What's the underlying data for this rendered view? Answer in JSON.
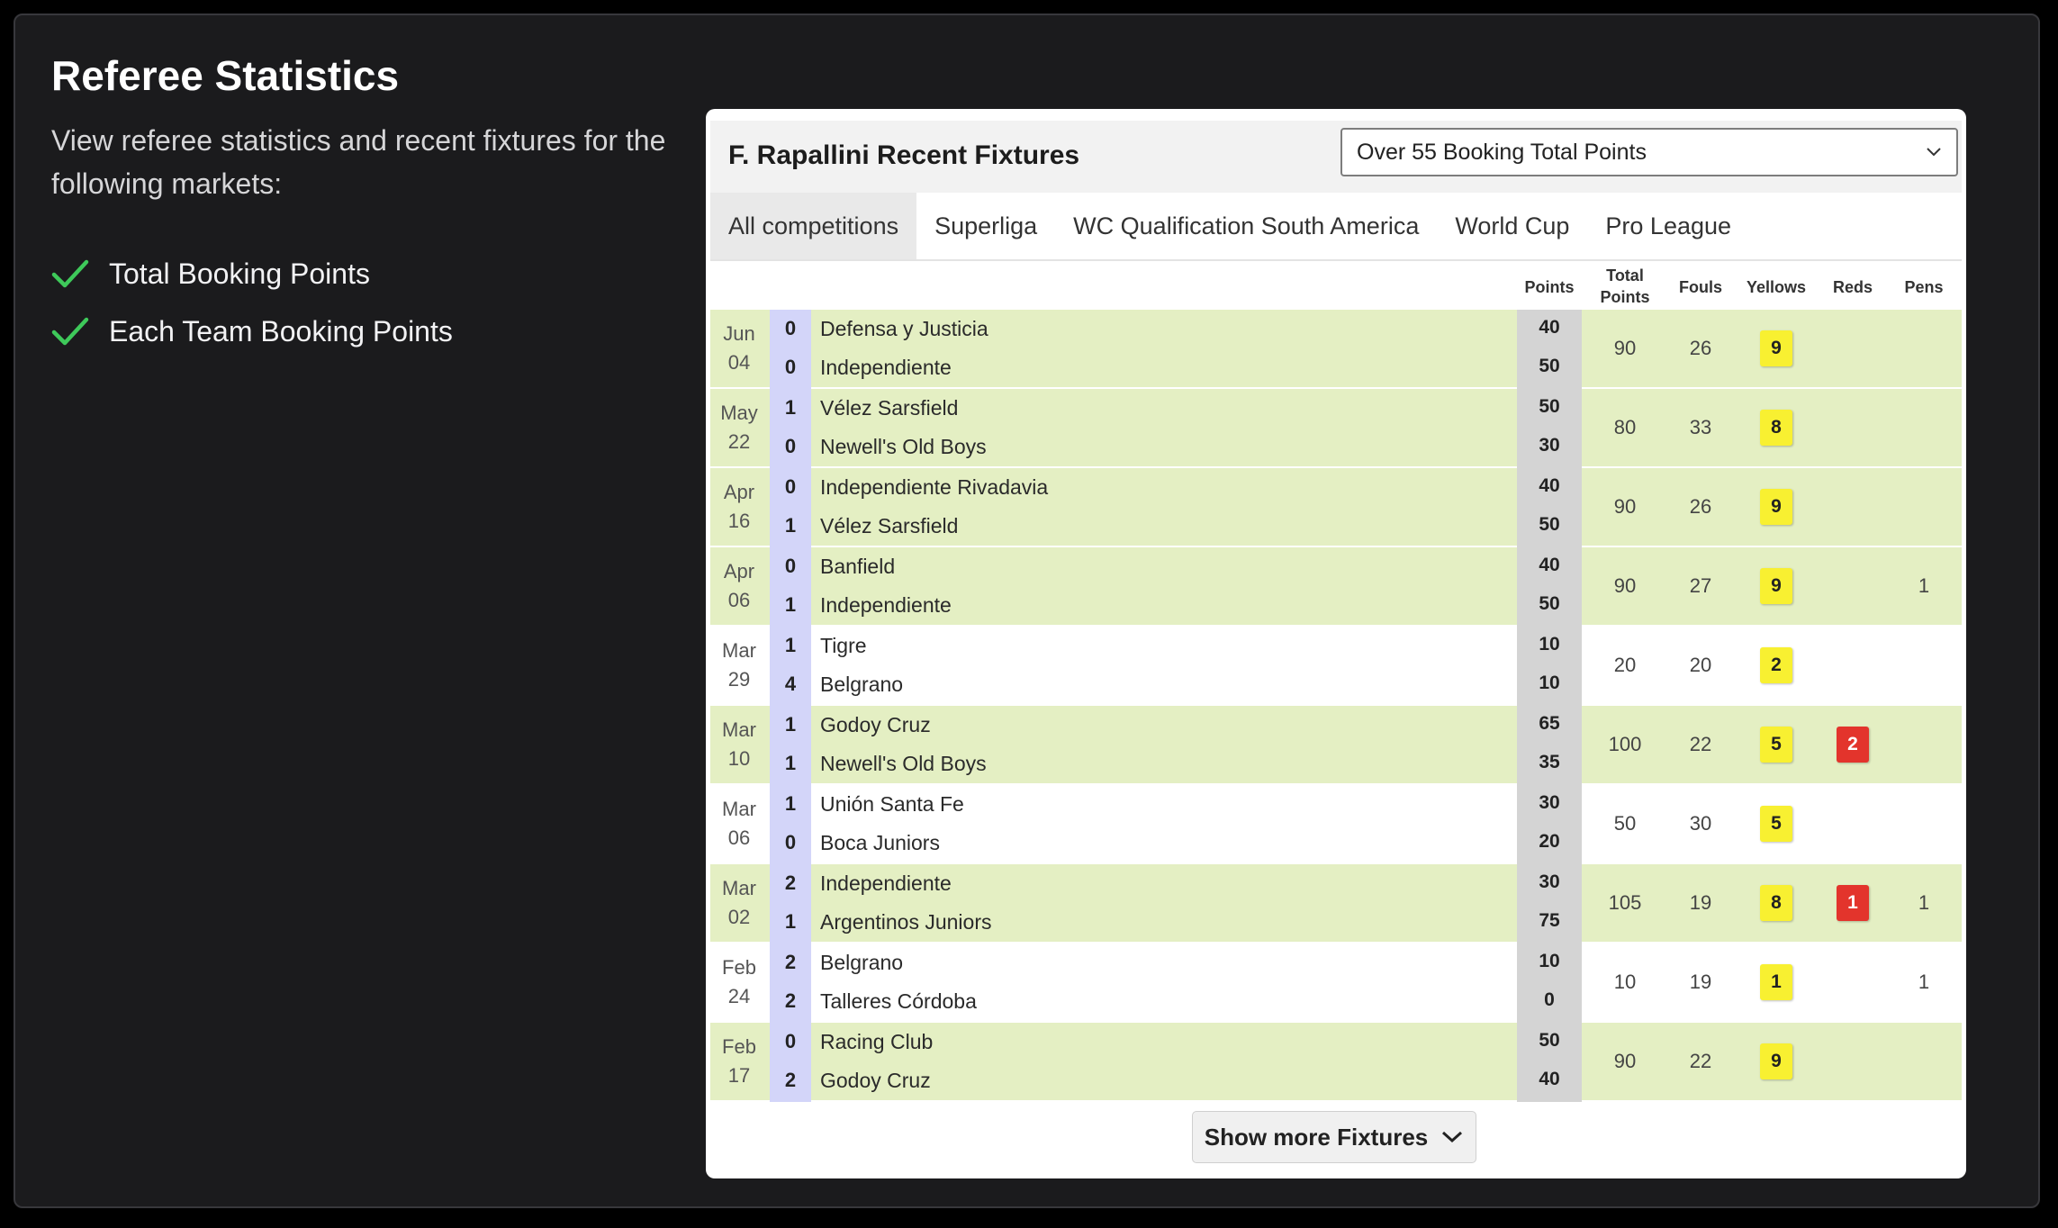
{
  "page": {
    "title": "Referee Statistics",
    "description": "View referee statistics and recent fixtures for the following markets:",
    "features": [
      {
        "label": "Total Booking Points",
        "icon": "check-icon"
      },
      {
        "label": "Each Team Booking Points",
        "icon": "check-icon"
      }
    ]
  },
  "widget": {
    "title": "F. Rapallini Recent Fixtures",
    "market_select": {
      "value": "Over 55 Booking Total Points",
      "icon": "chevron-down-icon"
    },
    "tabs": [
      {
        "label": "All competitions",
        "active": true
      },
      {
        "label": "Superliga",
        "active": false
      },
      {
        "label": "WC Qualification South America",
        "active": false
      },
      {
        "label": "World Cup",
        "active": false
      },
      {
        "label": "Pro League",
        "active": false
      }
    ],
    "columns": {
      "points": "Points",
      "total_line1": "Total",
      "total_line2": "Points",
      "fouls": "Fouls",
      "yellows": "Yellows",
      "reds": "Reds",
      "pens": "Pens"
    },
    "fixtures": [
      {
        "month": "Jun",
        "day": "04",
        "home": "Defensa y Justicia",
        "away": "Independiente",
        "home_score": "0",
        "away_score": "0",
        "home_points": "40",
        "away_points": "50",
        "total": "90",
        "fouls": "26",
        "yellows": "9",
        "reds": "",
        "pens": "",
        "highlight": true
      },
      {
        "month": "May",
        "day": "22",
        "home": "Vélez Sarsfield",
        "away": "Newell's Old Boys",
        "home_score": "1",
        "away_score": "0",
        "home_points": "50",
        "away_points": "30",
        "total": "80",
        "fouls": "33",
        "yellows": "8",
        "reds": "",
        "pens": "",
        "highlight": true
      },
      {
        "month": "Apr",
        "day": "16",
        "home": "Independiente Rivadavia",
        "away": "Vélez Sarsfield",
        "home_score": "0",
        "away_score": "1",
        "home_points": "40",
        "away_points": "50",
        "total": "90",
        "fouls": "26",
        "yellows": "9",
        "reds": "",
        "pens": "",
        "highlight": true
      },
      {
        "month": "Apr",
        "day": "06",
        "home": "Banfield",
        "away": "Independiente",
        "home_score": "0",
        "away_score": "1",
        "home_points": "40",
        "away_points": "50",
        "total": "90",
        "fouls": "27",
        "yellows": "9",
        "reds": "",
        "pens": "1",
        "highlight": true
      },
      {
        "month": "Mar",
        "day": "29",
        "home": "Tigre",
        "away": "Belgrano",
        "home_score": "1",
        "away_score": "4",
        "home_points": "10",
        "away_points": "10",
        "total": "20",
        "fouls": "20",
        "yellows": "2",
        "reds": "",
        "pens": "",
        "highlight": false
      },
      {
        "month": "Mar",
        "day": "10",
        "home": "Godoy Cruz",
        "away": "Newell's Old Boys",
        "home_score": "1",
        "away_score": "1",
        "home_points": "65",
        "away_points": "35",
        "total": "100",
        "fouls": "22",
        "yellows": "5",
        "reds": "2",
        "pens": "",
        "highlight": true
      },
      {
        "month": "Mar",
        "day": "06",
        "home": "Unión Santa Fe",
        "away": "Boca Juniors",
        "home_score": "1",
        "away_score": "0",
        "home_points": "30",
        "away_points": "20",
        "total": "50",
        "fouls": "30",
        "yellows": "5",
        "reds": "",
        "pens": "",
        "highlight": false
      },
      {
        "month": "Mar",
        "day": "02",
        "home": "Independiente",
        "away": "Argentinos Juniors",
        "home_score": "2",
        "away_score": "1",
        "home_points": "30",
        "away_points": "75",
        "total": "105",
        "fouls": "19",
        "yellows": "8",
        "reds": "1",
        "pens": "1",
        "highlight": true
      },
      {
        "month": "Feb",
        "day": "24",
        "home": "Belgrano",
        "away": "Talleres Córdoba",
        "home_score": "2",
        "away_score": "2",
        "home_points": "10",
        "away_points": "0",
        "total": "10",
        "fouls": "19",
        "yellows": "1",
        "reds": "",
        "pens": "1",
        "highlight": false
      },
      {
        "month": "Feb",
        "day": "17",
        "home": "Racing Club",
        "away": "Godoy Cruz",
        "home_score": "0",
        "away_score": "2",
        "home_points": "50",
        "away_points": "40",
        "total": "90",
        "fouls": "22",
        "yellows": "9",
        "reds": "",
        "pens": "",
        "highlight": true
      }
    ],
    "show_more": {
      "label": "Show more Fixtures",
      "icon": "chevron-down-icon"
    }
  },
  "colors": {
    "highlight_row": "#e4efc3",
    "score_column": "#d3d5f9",
    "points_column": "#d4d4d4",
    "yellow_card": "#f8f031",
    "red_card": "#e3342c",
    "check": "#3ec95a"
  }
}
